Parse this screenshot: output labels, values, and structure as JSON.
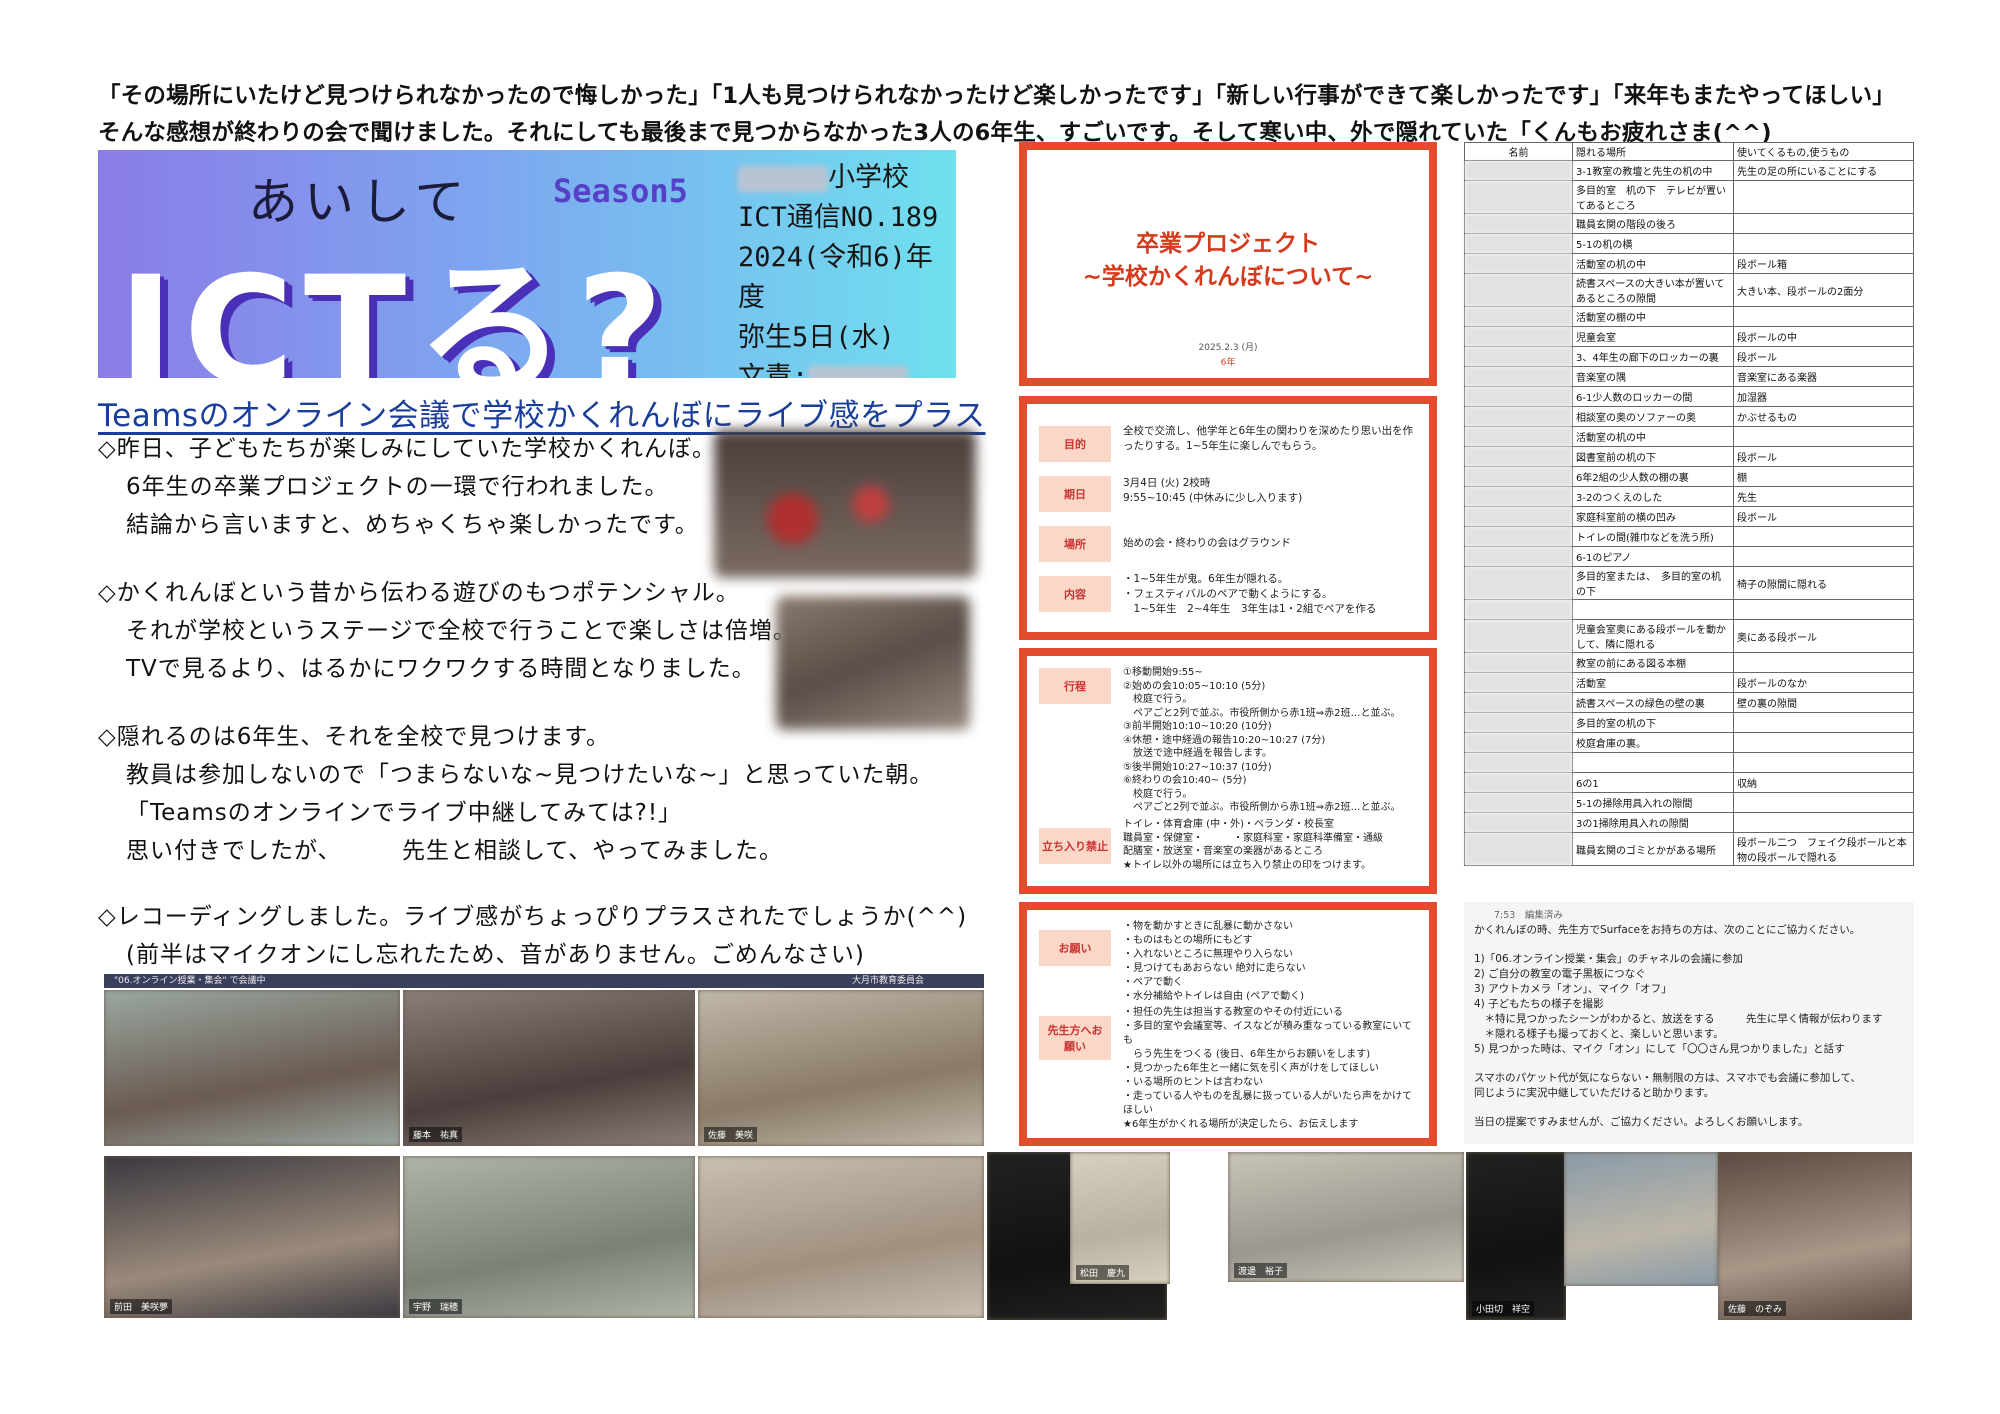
{
  "intro": "「その場所にいたけど見つけられなかったので悔しかった」「1人も見つけられなかったけど楽しかったです」「新しい行事ができて楽しかったです」「来年もまたやってほしい」そんな感想が終わりの会で聞けました。それにしても最後まで見つからなかった3人の6年生、すごいです。そして寒い中、外で隠れていた「くんもお疲れさま(^^)",
  "banner": {
    "aishite": "あいして",
    "season": "Season5",
    "ictru": "ICTる?",
    "school": "小学校",
    "issue": "ICT通信NO.189",
    "year": "2024(令和6)年度",
    "date": "弥生5日(水)",
    "author": "文責:"
  },
  "headline": "Teamsのオンライン会議で学校かくれんぼにライブ感をプラス",
  "paragraphs": [
    {
      "lead": "◇昨日、子どもたちが楽しみにしていた学校かくれんぼ。",
      "lines": [
        "6年生の卒業プロジェクトの一環で行われました。",
        "結論から言いますと、めちゃくちゃ楽しかったです。"
      ]
    },
    {
      "lead": "◇かくれんぼという昔から伝わる遊びのもつポテンシャル。",
      "lines": [
        "それが学校というステージで全校で行うことで楽しさは倍増。",
        "TVで見るより、はるかにワクワクする時間となりました。"
      ]
    },
    {
      "lead": "◇隠れるのは6年生、それを全校で見つけます。",
      "lines": [
        "教員は参加しないので「つまらないな~見つけたいな~」と思っていた朝。",
        "「Teamsのオンラインでライブ中継してみては?!」",
        "思い付きでしたが、　　　先生と相談して、やってみました。"
      ]
    },
    {
      "lead": "◇レコーディングしました。ライブ感がちょっぴりプラスされたでしょうか(^^)",
      "lines": [
        "(前半はマイクオンにし忘れたため、音がありません。ごめんなさい)"
      ]
    }
  ],
  "slide1": {
    "title_l1": "卒業プロジェクト",
    "title_l2": "~学校かくれんぼについて~",
    "date": "2025.2.3 (月)",
    "grade": "6年"
  },
  "slide2": [
    {
      "tag": "目的",
      "text": "全校で交流し、他学年と6年生の関わりを深めたり思い出を作ったりする。1~5年生に楽しんでもらう。"
    },
    {
      "tag": "期日",
      "text": "3月4日 (火) 2校時\n9:55~10:45 (中休みに少し入ります)"
    },
    {
      "tag": "場所",
      "text": "始めの会・終わりの会はグラウンド"
    },
    {
      "tag": "内容",
      "text": "・1~5年生が鬼。6年生が隠れる。\n・フェスティバルのペアで動くようにする。\n　1~5年生　2~4年生　3年生は1・2組でペアを作る"
    }
  ],
  "slide3": {
    "tag1": "行程",
    "text1": "①移動開始9:55~\n②始めの会10:05~10:10 (5分)\n　校庭で行う。\n　ペアごと2列で並ぶ。市役所側から赤1班⇒赤2班…と並ぶ。\n③前半開始10:10~10:20 (10分)\n④休憩・途中経過の報告10:20~10:27 (7分)\n　放送で途中経過を報告します。\n⑤後半開始10:27~10:37 (10分)\n⑥終わりの会10:40~ (5分)\n　校庭で行う。\n　ペアごと2列で並ぶ。市役所側から赤1班⇒赤2班…と並ぶ。",
    "tag2": "立ち入り禁止",
    "text2": "トイレ・体育倉庫 (中・外)・ベランダ・校長室\n職員室・保健室・　　　・家庭科室・家庭科準備室・通級\n配膳室・放送室・音楽室の楽器があるところ\n★トイレ以外の場所には立ち入り禁止の印をつけます。"
  },
  "slide4": {
    "tag1": "お願い",
    "text1": "・物を動かすときに乱暴に動かさない\n・ものはもとの場所にもどす\n・入れないところに無理やり入らない\n・見つけてもあおらない 絶対に走らない\n・ペアで動く\n・水分補給やトイレは自由 (ペアで動く)",
    "tag2": "先生方へお願い",
    "text2": "・担任の先生は担当する教室のやその付近にいる\n・多目的室や会議室等、イスなどが積み重なっている教室にいても\n　らう先生をつくる (後日、6年生からお願いをします)\n・見つかった6年生と一緒に気を引く声がけをしてほしい\n・いる場所のヒントは言わない\n・走っている人やものを乱暴に扱っている人がいたら声をかけてほしい\n★6年生がかくれる場所が決定したら、お伝えします"
  },
  "table": {
    "headers": [
      "名前",
      "隠れる場所",
      "使いてくるもの,使うもの"
    ],
    "rows": [
      [
        "",
        "3-1教室の教壇と先生の机の中",
        "先生の足の所にいることにする"
      ],
      [
        "",
        "多目的室　机の下　テレビが置いてあるところ",
        ""
      ],
      [
        "",
        "職員玄関の階段の後ろ",
        ""
      ],
      [
        "",
        "5-1の机の横",
        ""
      ],
      [
        "",
        "活動室の机の中",
        "段ボール箱"
      ],
      [
        "",
        "読書スペースの大きい本が置いてあるところの隙間",
        "大きい本、段ボールの2面分"
      ],
      [
        "",
        "活動室の棚の中",
        ""
      ],
      [
        "",
        "児童会室",
        "段ボールの中"
      ],
      [
        "",
        "3、4年生の廊下のロッカーの裏",
        "段ボール"
      ],
      [
        "",
        "音楽室の隅",
        "音楽室にある楽器"
      ],
      [
        "",
        "6-1少人数のロッカーの間",
        "加湿器"
      ],
      [
        "",
        "相談室の奥のソファーの奥",
        "かぶせるもの"
      ],
      [
        "",
        "活動室の机の中",
        ""
      ],
      [
        "",
        "図書室前の机の下",
        "段ボール"
      ],
      [
        "",
        "6年2組の少人数の棚の裏",
        "棚"
      ],
      [
        "",
        "3-2のつくえのした",
        "先生"
      ],
      [
        "",
        "家庭科室前の横の凹み",
        "段ボール"
      ],
      [
        "",
        "トイレの間(雑巾などを洗う所)",
        ""
      ],
      [
        "",
        "6-1のピアノ",
        ""
      ],
      [
        "",
        "多目的室または、　多目的室の机の下",
        "椅子の隙間に隠れる"
      ],
      [
        "",
        "",
        ""
      ],
      [
        "",
        "児童会室奥にある段ボールを動かして、隣に隠れる",
        "奥にある段ボール"
      ],
      [
        "",
        "教室の前にある図る本棚",
        ""
      ],
      [
        "",
        "活動室",
        "段ボールのなか"
      ],
      [
        "",
        "読書スペースの緑色の壁の裏",
        "壁の裏の隙間"
      ],
      [
        "",
        "多目的室の机の下",
        ""
      ],
      [
        "",
        "校庭倉庫の裏。",
        ""
      ],
      [
        "",
        "",
        ""
      ],
      [
        "",
        "6の1",
        "収納"
      ],
      [
        "",
        "5-1の掃除用具入れの隙間",
        ""
      ],
      [
        "",
        "3の1掃除用具入れの隙間",
        ""
      ],
      [
        "",
        "職員玄関のゴミとかがある場所",
        "段ボール二つ　フェイク段ボールと本物の段ボールで隠れる"
      ]
    ]
  },
  "chat": {
    "time": "7:53　編集済み",
    "lines": [
      "かくれんぼの時、先生方でSurfaceをお持ちの方は、次のことにご協力ください。",
      "",
      "1)「06.オンライン授業・集会」のチャネルの会議に参加",
      "2) ご自分の教室の電子黒板につなぐ",
      "3) アウトカメラ「オン」、マイク「オフ」",
      "4) 子どもたちの様子を撮影",
      "　＊特に見つかったシーンがわかると、放送をする　　　先生に早く情報が伝わります",
      "　＊隠れる様子も撮っておくと、楽しいと思います。",
      "5) 見つかった時は、マイク「オン」にして「〇〇さん見つかりました」と話す",
      "",
      "スマホのパケット代が気にならない・無制限の方は、スマホでも会議に参加して、",
      "同じように実況中継していただけると助かります。",
      "",
      "当日の提案ですみませんが、ご協力ください。よろしくお願いします。"
    ]
  },
  "video_bar": "\"06.オンライン授業・集会\" で会議中",
  "video_bar_right": "大月市教育委員会",
  "video_labels": [
    "",
    "藤本　祐真",
    "佐藤　美咲",
    "前田　美咲夢",
    "宇野　瑞穂",
    "",
    "",
    "松田　慶九",
    "渡邊　裕子",
    "小田切　祥空",
    "",
    "佐藤　のぞみ"
  ],
  "colors": {
    "accent": "#e24b2e",
    "headline": "#1a3e9a"
  }
}
